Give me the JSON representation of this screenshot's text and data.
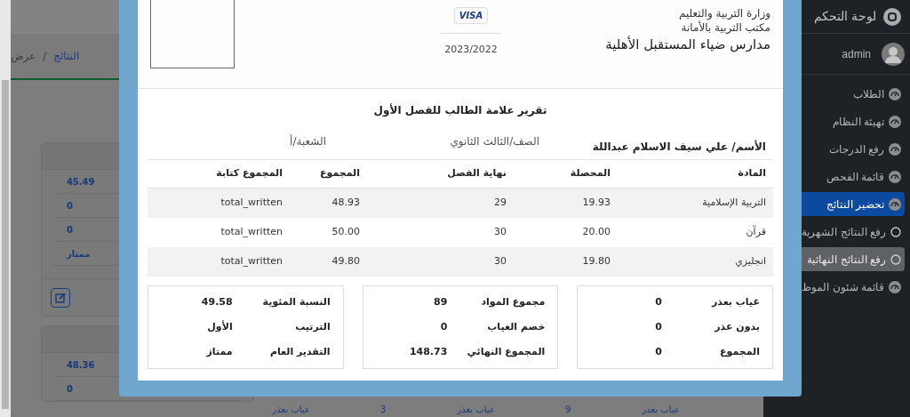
{
  "sidebar": {
    "brand": "لوحة التحكم",
    "user": "admin",
    "items": [
      {
        "label": "الطلاب",
        "kind": "main",
        "selected": false
      },
      {
        "label": "تهيئة النظام",
        "kind": "main",
        "selected": false
      },
      {
        "label": "رفع الدرجات",
        "kind": "main",
        "selected": false
      },
      {
        "label": "قائمة الفحص",
        "kind": "main",
        "selected": false
      },
      {
        "label": "تحضير النتائج",
        "kind": "main",
        "selected": true
      },
      {
        "label": "رفع النتائج الشهرية",
        "kind": "sub",
        "selected": false
      },
      {
        "label": "رفع النتائج النهائية",
        "kind": "sub",
        "selected": true
      },
      {
        "label": "قائمة شئون الموظ",
        "kind": "main",
        "selected": false
      }
    ]
  },
  "breadcrumb": [
    "النتائج",
    "/",
    "عرض"
  ],
  "background_cards": [
    {
      "values": [
        "45.49",
        "0",
        "0",
        "ممتاز"
      ],
      "has_edit": true
    },
    {
      "values": [
        "48.36",
        "0"
      ],
      "has_edit": false
    }
  ],
  "background_bottom_row": [
    "غياب بعذر",
    "9",
    "غياب بعذر",
    "3",
    "غياب بعذر"
  ],
  "report": {
    "header": {
      "lines": [
        "وزارة التربية والتعليم",
        "مكتب التربية بالأمانة"
      ],
      "school": "مدارس ضياء المستقبل الأهلية",
      "badge": "VISA",
      "year": "2023/2022"
    },
    "title": "تقرير علامة الطالب للفصل الأول",
    "info": [
      "الأسم/ علي سيف الاسلام عبداللة",
      "الصف/الثالث الثانوي",
      "الشعبة/أ"
    ],
    "table": {
      "columns": [
        "المادة",
        "المحصلة",
        "نهاية الفصل",
        "المجموع",
        "المجموع كتابة"
      ],
      "rows": [
        [
          "التربية الإسلامية",
          "19.93",
          "29",
          "48.93",
          "total_written"
        ],
        [
          "قرآن",
          "20.00",
          "30",
          "50.00",
          "total_written"
        ],
        [
          "انجليزي",
          "19.80",
          "30",
          "49.80",
          "total_written"
        ]
      ]
    },
    "summary": [
      [
        {
          "label": "غياب بعذر",
          "value": "0"
        },
        {
          "label": "بدون عذر",
          "value": "0"
        },
        {
          "label": "المجموع",
          "value": "0"
        }
      ],
      [
        {
          "label": "مجموع المواد",
          "value": "89"
        },
        {
          "label": "خصم الغياب",
          "value": "0"
        },
        {
          "label": "المجموع النهائي",
          "value": "148.73"
        }
      ],
      [
        {
          "label": "النسبة المئوية",
          "value": "49.58"
        },
        {
          "label": "الترتيب",
          "value": "الأول"
        },
        {
          "label": "التقدير العام",
          "value": "ممتاز"
        }
      ]
    ]
  }
}
